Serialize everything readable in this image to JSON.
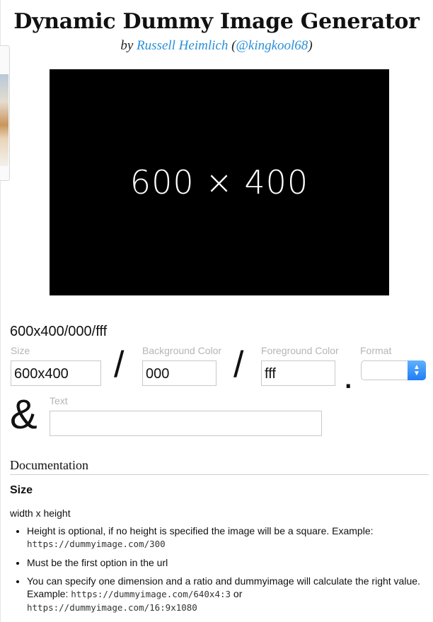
{
  "header": {
    "title": "Dynamic Dummy Image Generator",
    "byline_prefix": "by",
    "author_name": "Russell Heimlich",
    "author_handle": "(@kingkool68)",
    "open_paren": "(",
    "handle_text": "@kingkool68",
    "close_paren": ")"
  },
  "preview": {
    "label": "600 × 400",
    "background": "#000000",
    "foreground": "#ffffff"
  },
  "generator": {
    "current_url": "600x400/000/fff",
    "size_label": "Size",
    "size_value": "600x400",
    "bg_label": "Background Color",
    "bg_value": "000",
    "fg_label": "Foreground Color",
    "fg_value": "fff",
    "format_label": "Format",
    "format_value": "",
    "text_label": "Text",
    "text_value": "",
    "slash": "/",
    "dot": ".",
    "ampersand": "&"
  },
  "docs": {
    "heading": "Documentation",
    "size_section": {
      "title": "Size",
      "lead": "width x height",
      "item1_text": "Height is optional, if no height is specified the image will be a square. Example:",
      "item1_code": "https://dummyimage.com/300",
      "item2_text": "Must be the first option in the url",
      "item3_text": "You can specify one dimension and a ratio and dummyimage will calculate the right value. Example:",
      "item3_code1": "https://dummyimage.com/640x4:3",
      "item3_or": "or",
      "item3_code2": "https://dummyimage.com/16:9x1080"
    }
  },
  "colors": {
    "link": "#2a8fd8",
    "placeholder_label": "#b5b5b5",
    "select_accent": "#1f7ef5"
  }
}
